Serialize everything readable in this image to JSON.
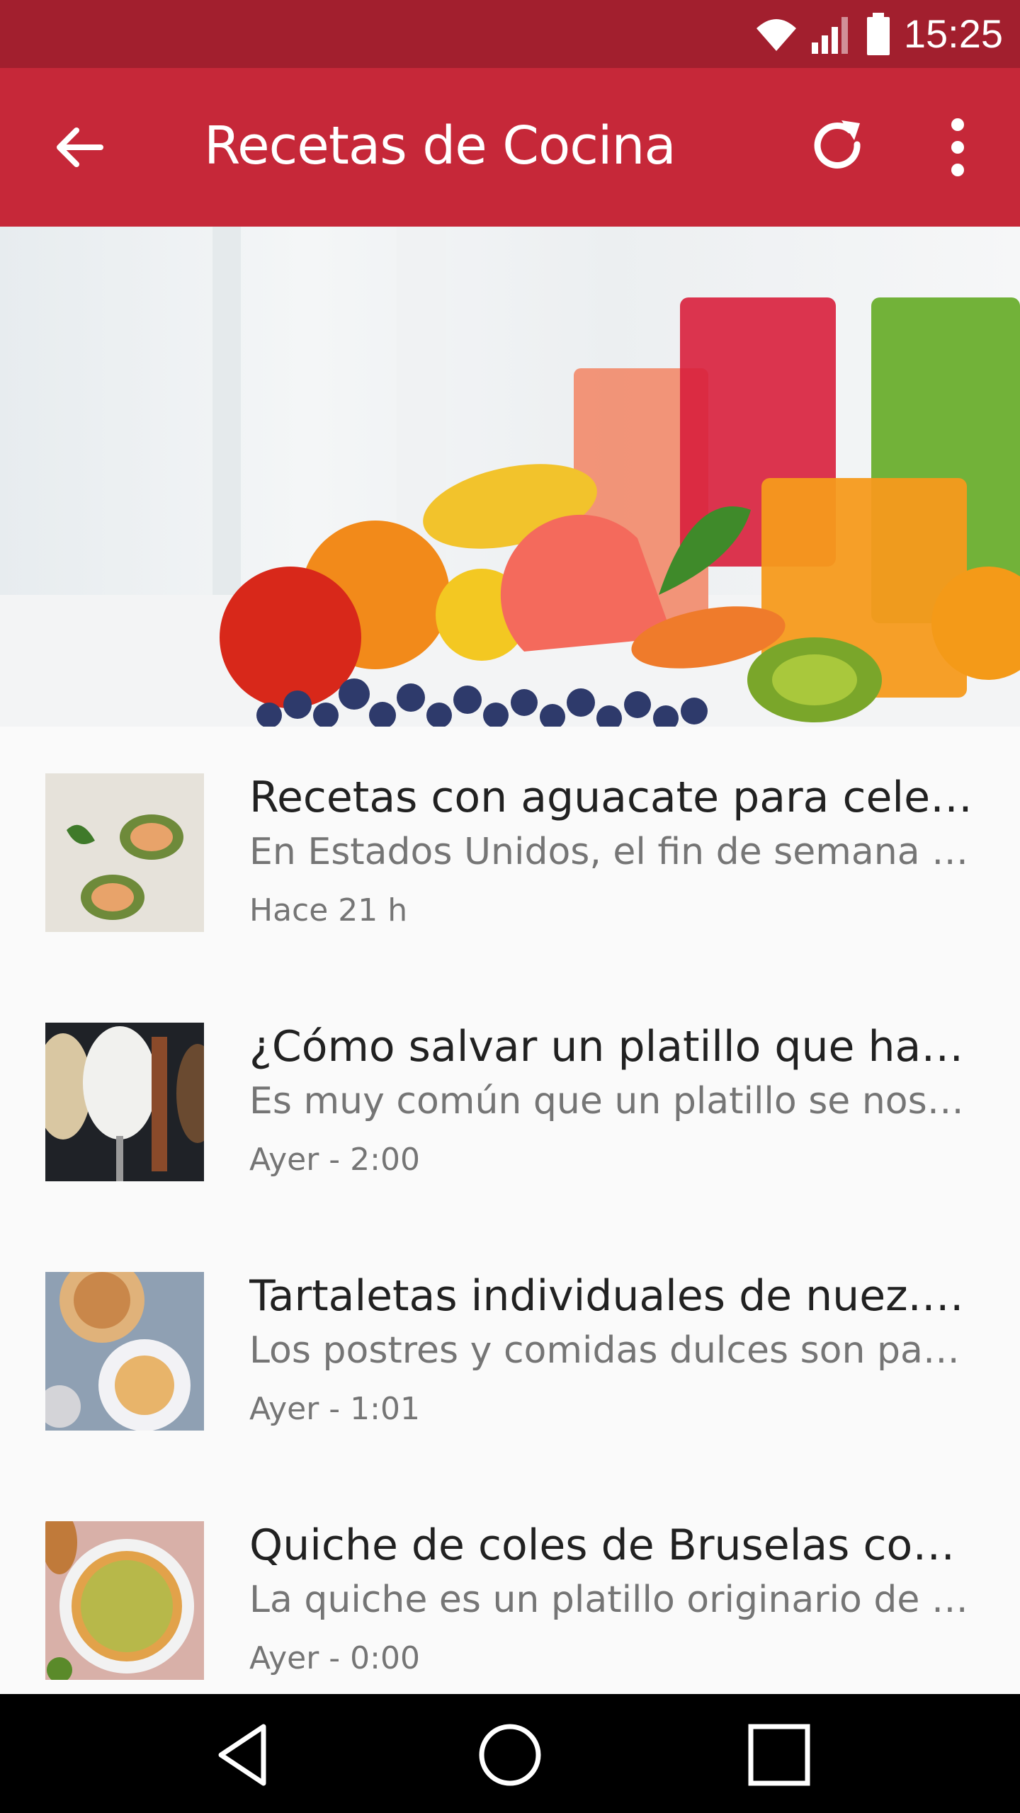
{
  "status_bar": {
    "time": "15:25",
    "icons": [
      "wifi-icon",
      "signal-icon",
      "battery-icon"
    ]
  },
  "app_bar": {
    "title": "Recetas de Cocina",
    "back_icon": "arrow-left-icon",
    "refresh_icon": "refresh-icon",
    "more_icon": "more-vert-icon",
    "color": "#c62839",
    "status_color": "#a21f2e"
  },
  "hero": {
    "subject": "juices and fruits photo"
  },
  "articles": [
    {
      "title": "Recetas con aguacate para celebr…",
      "description": "En Estados Unidos, el fin de semana de…",
      "date": "Hace 21 h"
    },
    {
      "title": "¿Cómo salvar un platillo que ha qu…",
      "description": "Es muy común que un platillo se nos pa…",
      "date": "Ayer - 2:00"
    },
    {
      "title": "Tartaletas individuales de nuez. R…",
      "description": "Los postres y comidas dulces son part…",
      "date": "Ayer - 1:01"
    },
    {
      "title": "Quiche de coles de Bruselas con c…",
      "description": "La quiche es un platillo originario de Fr…",
      "date": "Ayer - 0:00"
    }
  ],
  "nav_bar": {
    "buttons": [
      "back-triangle-icon",
      "home-circle-icon",
      "recents-square-icon"
    ]
  }
}
